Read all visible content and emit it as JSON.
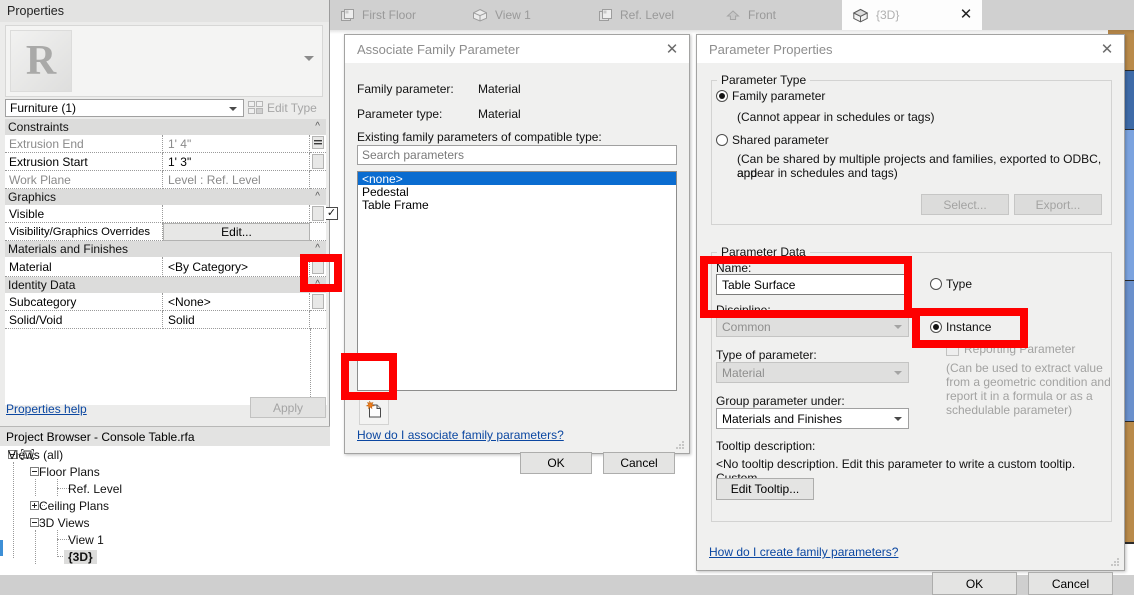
{
  "view_tabs": [
    {
      "label": "First Floor",
      "icon": "floorplan-icon",
      "active": false
    },
    {
      "label": "View 1",
      "icon": "house-3d-icon",
      "active": false
    },
    {
      "label": "Ref. Level",
      "icon": "floorplan-icon",
      "active": false
    },
    {
      "label": "Front",
      "icon": "elevation-arrow-icon",
      "active": false
    },
    {
      "label": "{3D}",
      "icon": "house-3d-icon",
      "active": true
    }
  ],
  "properties": {
    "title": "Properties",
    "thumbnail_letter": "R",
    "type_selector_value": "Furniture (1)",
    "edit_type_label": "Edit Type",
    "help_link": "Properties help",
    "apply_label": "Apply",
    "groups": [
      {
        "name": "Constraints",
        "rows": [
          {
            "name": "Extrusion End",
            "value": "1'  4\"",
            "name_dim": true
          },
          {
            "name": "Extrusion Start",
            "value": "1'  3\"",
            "name_dim": false
          },
          {
            "name": "Work Plane",
            "value": "Level : Ref. Level",
            "name_dim": true
          }
        ]
      },
      {
        "name": "Graphics",
        "rows": [
          {
            "name": "Visible",
            "value": "",
            "name_dim": false,
            "control": "checkbox",
            "checked": true
          },
          {
            "name": "Visibility/Graphics Overrides",
            "value": "Edit...",
            "name_dim": false,
            "control": "button"
          }
        ]
      },
      {
        "name": "Materials and Finishes",
        "rows": [
          {
            "name": "Material",
            "value": "<By Category>",
            "name_dim": false,
            "control": "associate"
          }
        ]
      },
      {
        "name": "Identity Data",
        "rows": [
          {
            "name": "Subcategory",
            "value": "<None>",
            "name_dim": false
          },
          {
            "name": "Solid/Void",
            "value": "Solid",
            "name_dim": false
          }
        ]
      }
    ]
  },
  "project_browser": {
    "title": "Project Browser - Console Table.rfa",
    "nodes": [
      {
        "label": "Views (all)",
        "depth": 0,
        "expander": "minus",
        "icon": "views-icon",
        "selected": false
      },
      {
        "label": "Floor Plans",
        "depth": 1,
        "expander": "minus",
        "icon": "",
        "selected": false
      },
      {
        "label": "Ref. Level",
        "depth": 2,
        "expander": "none",
        "icon": "",
        "selected": false
      },
      {
        "label": "Ceiling Plans",
        "depth": 1,
        "expander": "plus",
        "icon": "",
        "selected": false
      },
      {
        "label": "3D Views",
        "depth": 1,
        "expander": "minus",
        "icon": "",
        "selected": false
      },
      {
        "label": "View 1",
        "depth": 2,
        "expander": "none",
        "icon": "",
        "selected": false
      },
      {
        "label": "{3D}",
        "depth": 2,
        "expander": "none",
        "icon": "",
        "selected": true
      }
    ]
  },
  "associate_dialog": {
    "title": "Associate Family Parameter",
    "family_parameter_label": "Family parameter:",
    "family_parameter_value": "Material",
    "parameter_type_label": "Parameter type:",
    "parameter_type_value": "Material",
    "existing_label": "Existing family parameters of compatible type:",
    "search_placeholder": "Search parameters",
    "search_value": "Search parameters",
    "list_items": [
      {
        "label": "<none>",
        "selected": true
      },
      {
        "label": "Pedestal",
        "selected": false
      },
      {
        "label": "Table Frame",
        "selected": false
      }
    ],
    "new_parameter_icon": "new-parameter-icon",
    "help_link": "How do I associate family parameters?",
    "ok_label": "OK",
    "cancel_label": "Cancel"
  },
  "parameter_dialog": {
    "title": "Parameter Properties",
    "parameter_type_group": "Parameter Type",
    "family_parameter_label": "Family parameter",
    "family_parameter_note": "(Cannot appear in schedules or tags)",
    "family_parameter_selected": true,
    "shared_parameter_label": "Shared parameter",
    "shared_parameter_note_line1": "(Can be shared by multiple projects and families, exported to ODBC, and",
    "shared_parameter_note_line2": "appear in schedules and tags)",
    "shared_parameter_selected": false,
    "select_label": "Select...",
    "export_label": "Export...",
    "parameter_data_group": "Parameter Data",
    "name_label": "Name:",
    "name_value": "Table Surface",
    "discipline_label": "Discipline:",
    "discipline_value": "Common",
    "type_of_parameter_label": "Type of parameter:",
    "type_of_parameter_value": "Material",
    "group_parameter_label": "Group parameter under:",
    "group_parameter_value": "Materials and Finishes",
    "type_radio_label": "Type",
    "type_radio_selected": false,
    "instance_radio_label": "Instance",
    "instance_radio_selected": true,
    "reporting_parameter_label": "Reporting Parameter",
    "reporting_parameter_checked": false,
    "reporting_note_line1": "(Can be used to extract value",
    "reporting_note_line2": "from a geometric condition and",
    "reporting_note_line3": "report it in a formula or as a",
    "reporting_note_line4": "schedulable parameter)",
    "tooltip_label": "Tooltip description:",
    "tooltip_value": "<No tooltip description. Edit this parameter to write a custom tooltip. Custom",
    "edit_tooltip_label": "Edit Tooltip...",
    "help_link": "How do I create family parameters?",
    "ok_label": "OK",
    "cancel_label": "Cancel"
  },
  "annotations": {
    "highlight_color": "#fe0000",
    "boxes": [
      {
        "name": "material-associate-button-highlight"
      },
      {
        "name": "new-parameter-button-highlight"
      },
      {
        "name": "parameter-name-field-highlight"
      },
      {
        "name": "instance-radio-highlight"
      }
    ]
  }
}
